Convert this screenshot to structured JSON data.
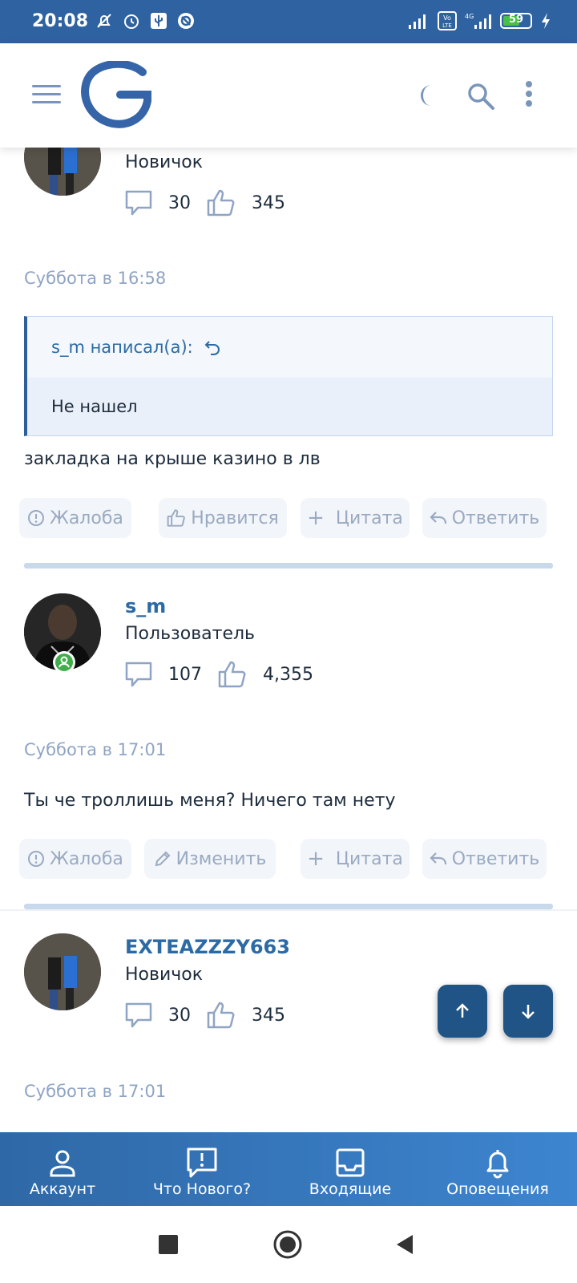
{
  "status_bar": {
    "time": "20:08",
    "battery": "59"
  },
  "header": {
    "logo": "forum-logo",
    "icons": [
      "menu-icon",
      "moon-icon",
      "search-icon",
      "more-icon"
    ]
  },
  "posts": [
    {
      "user": {
        "title": "Новичок",
        "messages": "30",
        "likes": "345"
      },
      "timestamp": "Суббота в 16:58",
      "quote": {
        "author": "s_m написал(а):",
        "text": "Не нашел"
      },
      "message": "закладка на крыше казино в лв",
      "actions": {
        "report": "Жалоба",
        "like": "Нравится",
        "quote": "Цитата",
        "reply": "Ответить"
      }
    },
    {
      "user": {
        "name": "s_m",
        "title": "Пользователь",
        "messages": "107",
        "likes": "4,355"
      },
      "timestamp": "Суббота в 17:01",
      "message": "Ты че троллишь меня? Ничего там нету",
      "actions": {
        "report": "Жалоба",
        "edit": "Изменить",
        "quote": "Цитата",
        "reply": "Ответить"
      }
    },
    {
      "user": {
        "name": "EXTEAZZZY663",
        "title": "Новичок",
        "messages": "30",
        "likes": "345"
      },
      "timestamp": "Суббота в 17:01"
    }
  ],
  "bottom_nav": [
    {
      "label": "Аккаунт",
      "icon": "account-icon"
    },
    {
      "label": "Что Нового?",
      "icon": "whats-new-icon"
    },
    {
      "label": "Входящие",
      "icon": "inbox-icon"
    },
    {
      "label": "Оповещения",
      "icon": "bell-icon"
    }
  ],
  "colors": {
    "accent": "#2f62a0",
    "username": "#2b6aa5",
    "timestamp": "#8fa4c4",
    "fab": "#205486"
  }
}
